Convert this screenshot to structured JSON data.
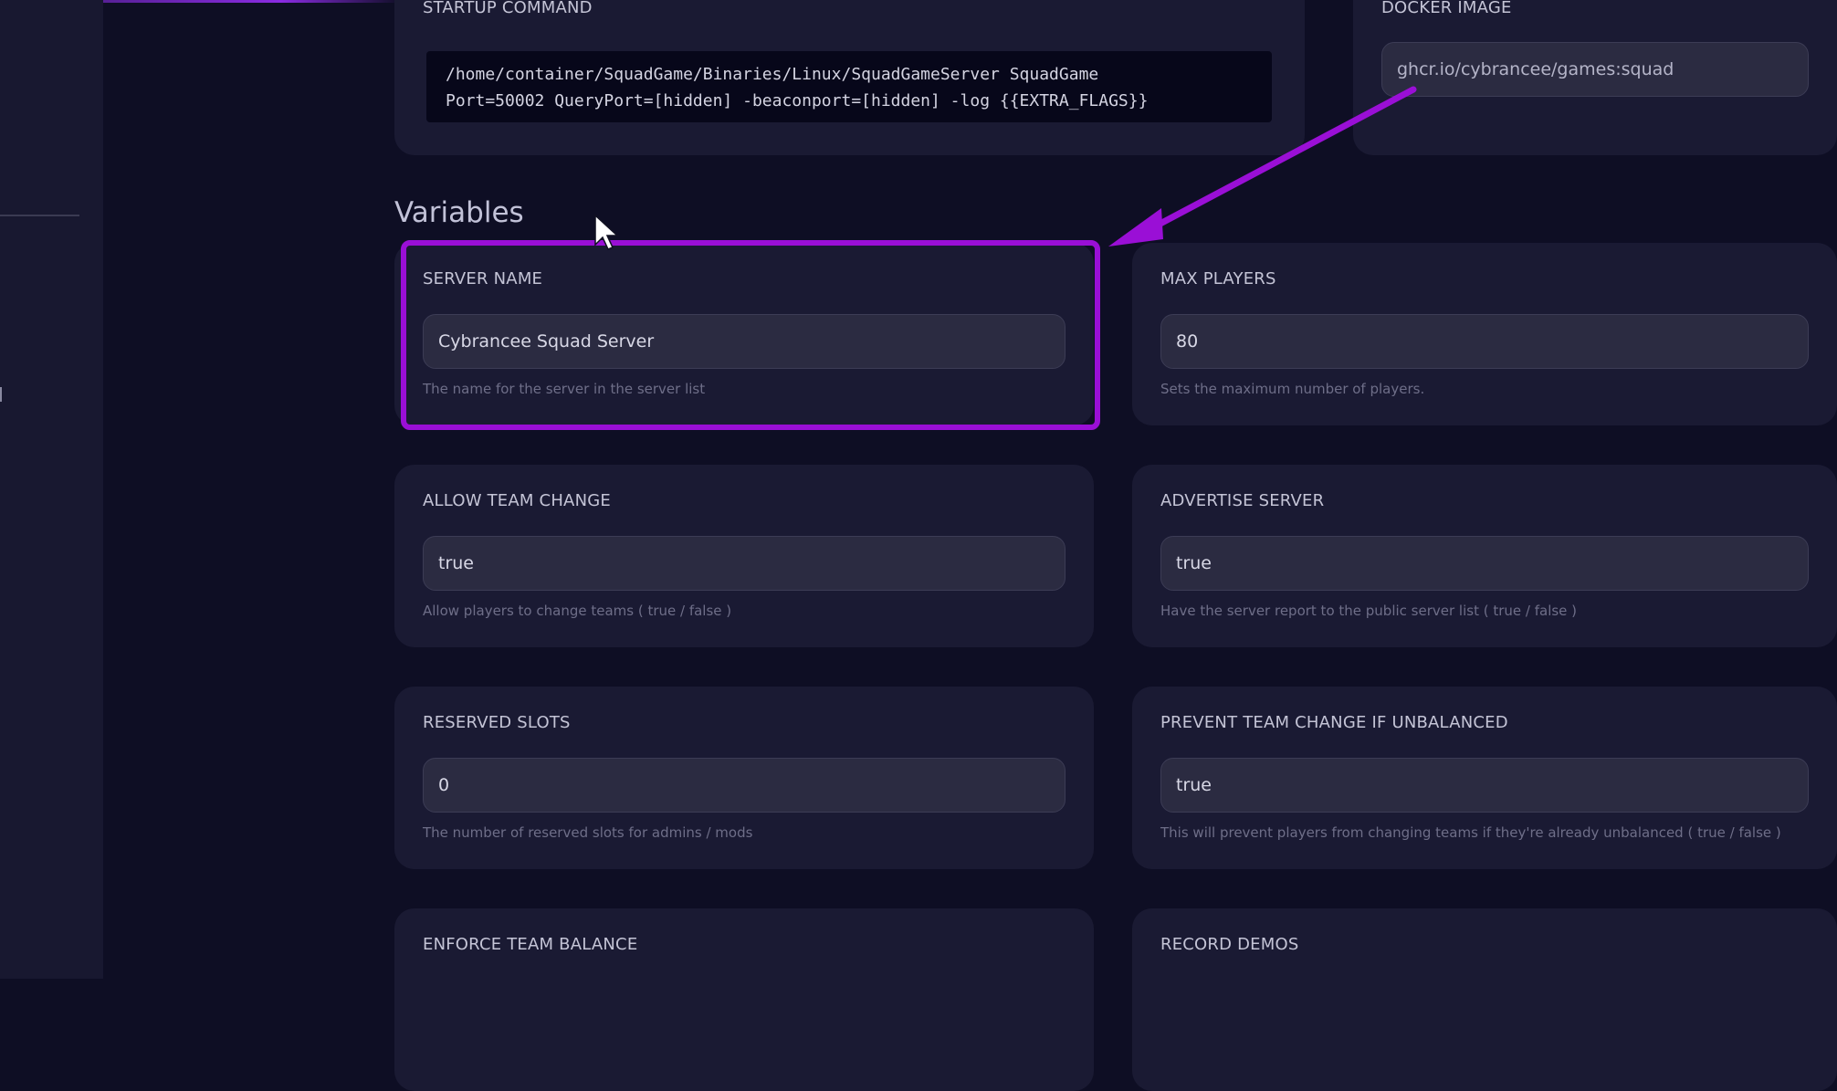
{
  "startup": {
    "label": "STARTUP COMMAND",
    "command_line_1": "/home/container/SquadGame/Binaries/Linux/SquadGameServer SquadGame",
    "command_line_2": "Port=50002 QueryPort=[hidden] -beaconport=[hidden] -log {{EXTRA_FLAGS}}"
  },
  "docker": {
    "label": "DOCKER IMAGE",
    "value": "ghcr.io/cybrancee/games:squad"
  },
  "section_title": "Variables",
  "variables": [
    {
      "label": "SERVER NAME",
      "value": "Cybrancee Squad Server",
      "description": "The name for the server in the server list"
    },
    {
      "label": "MAX PLAYERS",
      "value": "80",
      "description": "Sets the maximum number of players."
    },
    {
      "label": "ALLOW TEAM CHANGE",
      "value": "true",
      "description": "Allow players to change teams ( true / false )"
    },
    {
      "label": "ADVERTISE SERVER",
      "value": "true",
      "description": "Have the server report to the public server list ( true / false )"
    },
    {
      "label": "RESERVED SLOTS",
      "value": "0",
      "description": "The number of reserved slots for admins / mods"
    },
    {
      "label": "PREVENT TEAM CHANGE IF UNBALANCED",
      "value": "true",
      "description": "This will prevent players from changing teams if they're already unbalanced ( true / false )"
    },
    {
      "label": "ENFORCE TEAM BALANCE"
    },
    {
      "label": "RECORD DEMOS"
    }
  ],
  "colors": {
    "annotation": "#9a0fd6",
    "background": "#0e0e24",
    "card": "#1a1a33"
  }
}
